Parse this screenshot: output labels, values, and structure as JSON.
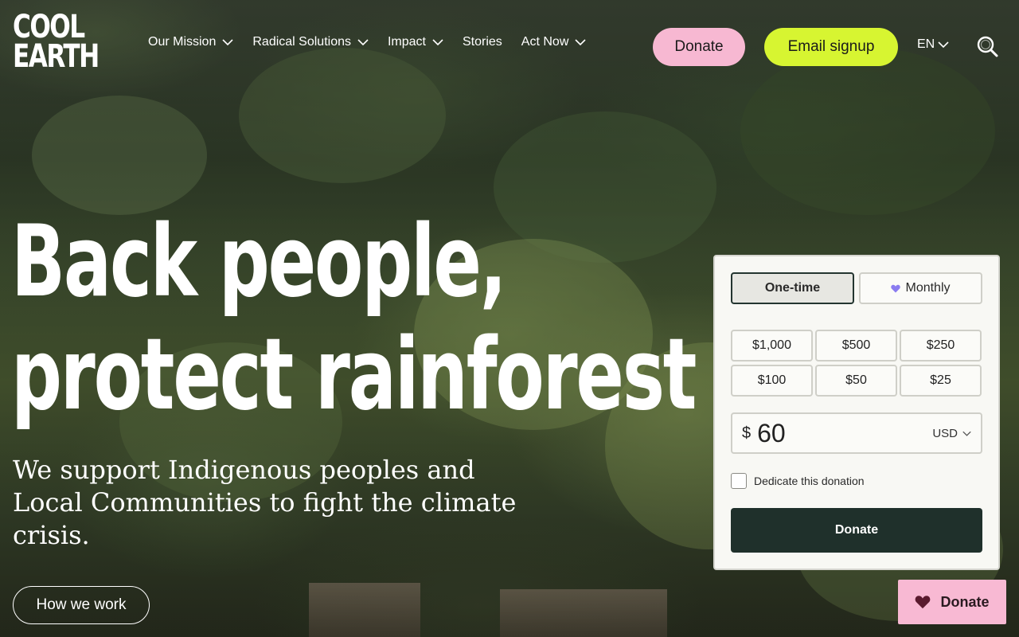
{
  "brand": {
    "logo_line1": "COOL",
    "logo_line2": "EARTH"
  },
  "nav": {
    "items": [
      {
        "label": "Our Mission",
        "has_dropdown": true
      },
      {
        "label": "Radical Solutions",
        "has_dropdown": true
      },
      {
        "label": "Impact",
        "has_dropdown": true
      },
      {
        "label": "Stories",
        "has_dropdown": false
      },
      {
        "label": "Act Now",
        "has_dropdown": true
      }
    ],
    "donate_label": "Donate",
    "email_label": "Email signup",
    "language": "EN",
    "search_icon": "search-icon"
  },
  "hero": {
    "headline_line1": "Back people,",
    "headline_line2": "protect rainforest",
    "subhead": "We support Indigenous peoples and Local Communities to fight the climate crisis.",
    "cta_label": "How we work"
  },
  "donation_form": {
    "frequency": {
      "one_time": "One-time",
      "monthly": "Monthly",
      "selected": "One-time"
    },
    "amounts": [
      "$1,000",
      "$500",
      "$250",
      "$100",
      "$50",
      "$25"
    ],
    "currency_symbol": "$",
    "amount_value": "60",
    "currency": "USD",
    "dedicate_label": "Dedicate this donation",
    "dedicate_checked": false,
    "submit_label": "Donate"
  },
  "floating_donate": {
    "label": "Donate"
  },
  "colors": {
    "donate_pink": "#f7b8d2",
    "signup_lime": "#d7f531",
    "form_button_dark": "#1f302b",
    "monthly_heart": "#8a7cf0",
    "float_heart": "#5a1a2e"
  }
}
